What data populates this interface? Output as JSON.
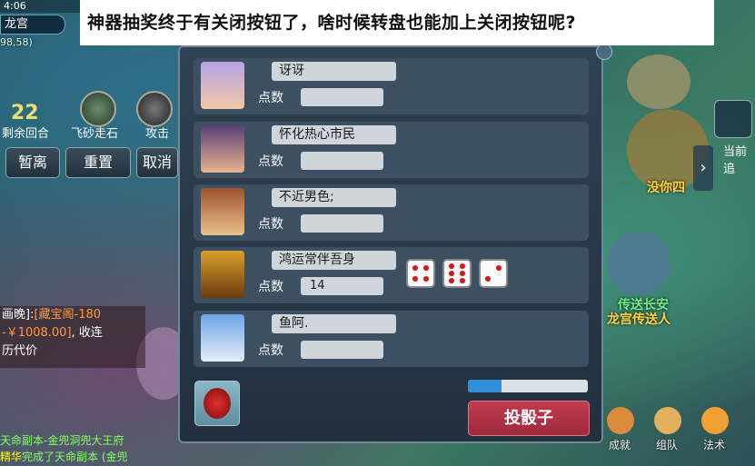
{
  "caption": "神器抽奖终于有关闭按钮了，啥时候转盘也能加上关闭按钮呢?",
  "status_bar": {
    "time": "4:06"
  },
  "location": {
    "map_name": "龙宫",
    "coords": "98,58)"
  },
  "left_hud": {
    "rounds_value": "22",
    "rounds_label": "剩余回合",
    "skill1_label": "飞砂走石",
    "skill2_label": "攻击",
    "buttons": [
      "暂离",
      "重置",
      "取消"
    ]
  },
  "chat": {
    "line1_prefix": "画晚]:",
    "line1_highlight": "[藏宝阁-180",
    "line2_highlight": "-￥1008.00]",
    "line2_suffix": ", 收连",
    "line3": "历代价",
    "bottom1": "天命副本-金兜洞兜大王府",
    "bottom2_prefix": "精华",
    "bottom2": "完成了天命副本 (金兜"
  },
  "right_hud": {
    "panel_label": "当前追",
    "npc1": "没你四",
    "npc2": "传送长安",
    "npc3": "龙宫传送人"
  },
  "bottom_bar": [
    "成就",
    "组队",
    "法术"
  ],
  "dice_panel": {
    "score_label": "点数",
    "players": [
      {
        "name": "讶讶",
        "score": ""
      },
      {
        "name": "怀化热心市民",
        "score": ""
      },
      {
        "name": "不近男色;",
        "score": ""
      },
      {
        "name": "鸿运常伴吾身",
        "score": "14",
        "dice": [
          4,
          6,
          2
        ]
      },
      {
        "name": "鱼阿.",
        "score": ""
      }
    ],
    "roll_button": "投骰子",
    "progress": 0.28,
    "accent": "#2f8fd8",
    "button_color": "#9e2a3c"
  }
}
